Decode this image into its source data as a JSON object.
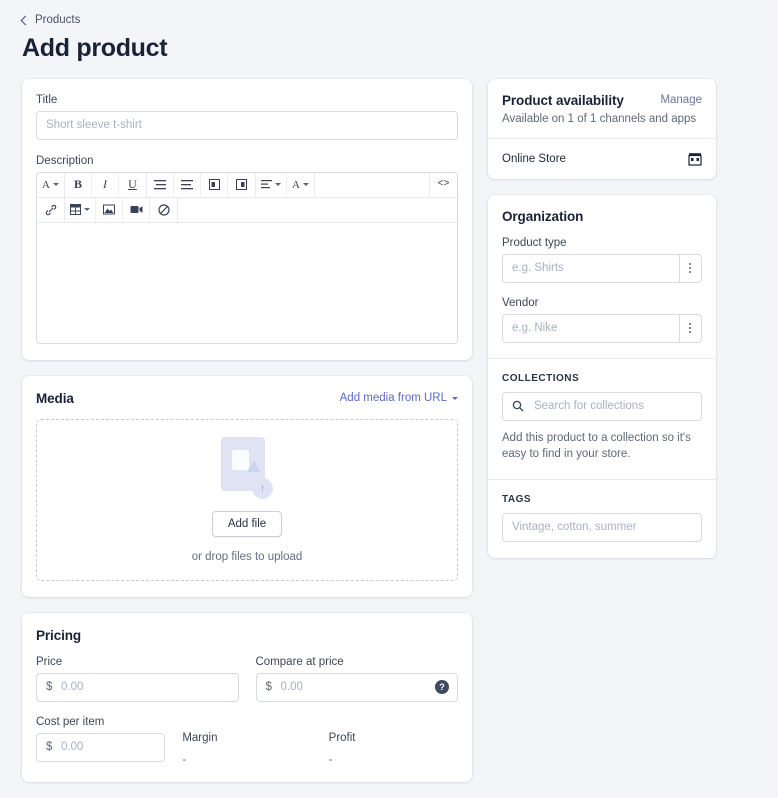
{
  "header": {
    "breadcrumb": "Products",
    "title": "Add product"
  },
  "product_form": {
    "title_label": "Title",
    "title_placeholder": "Short sleeve t-shirt",
    "title_value": "",
    "description_label": "Description",
    "description_value": "",
    "toolbar": {
      "font_size": "A",
      "bold": "B",
      "italic": "I",
      "underline": "U",
      "bulleted_list": "list-bulleted",
      "numbered_list": "list-numbered",
      "outdent": "outdent",
      "indent": "indent",
      "align": "align",
      "text_color": "A",
      "code_view": "<>",
      "link": "link",
      "table": "table",
      "image": "image",
      "video": "video",
      "clear_formatting": "clear"
    }
  },
  "media": {
    "title": "Media",
    "add_from_url": "Add media from URL",
    "add_file_button": "Add file",
    "drop_hint": "or drop files to upload",
    "upload_badge": "↑"
  },
  "pricing": {
    "title": "Pricing",
    "price_label": "Price",
    "price_placeholder": "0.00",
    "price_value": "",
    "compare_label": "Compare at price",
    "compare_placeholder": "0.00",
    "compare_value": "",
    "currency_symbol": "$",
    "help_icon": "?",
    "cost_label": "Cost per item",
    "cost_placeholder": "0.00",
    "cost_value": "",
    "margin_label": "Margin",
    "margin_value": "-",
    "profit_label": "Profit",
    "profit_value": "-"
  },
  "availability": {
    "title": "Product availability",
    "manage_link": "Manage",
    "subtitle": "Available on 1 of 1 channels and apps",
    "channel_name": "Online Store"
  },
  "organization": {
    "title": "Organization",
    "product_type_label": "Product type",
    "product_type_placeholder": "e.g. Shirts",
    "product_type_value": "",
    "vendor_label": "Vendor",
    "vendor_placeholder": "e.g. Nike",
    "vendor_value": "",
    "collections_label": "COLLECTIONS",
    "collections_placeholder": "Search for collections",
    "collections_value": "",
    "collections_help": "Add this product to a collection so it's easy to find in your store.",
    "tags_label": "TAGS",
    "tags_placeholder": "Vintage, cotton, summer",
    "tags_value": ""
  },
  "colors": {
    "page_bg": "#f4f5f9",
    "card_bg": "#ffffff",
    "text": "#212b36",
    "link": "#5c6ac4",
    "border": "#d6dae4",
    "placeholder": "#a9b0c0"
  }
}
